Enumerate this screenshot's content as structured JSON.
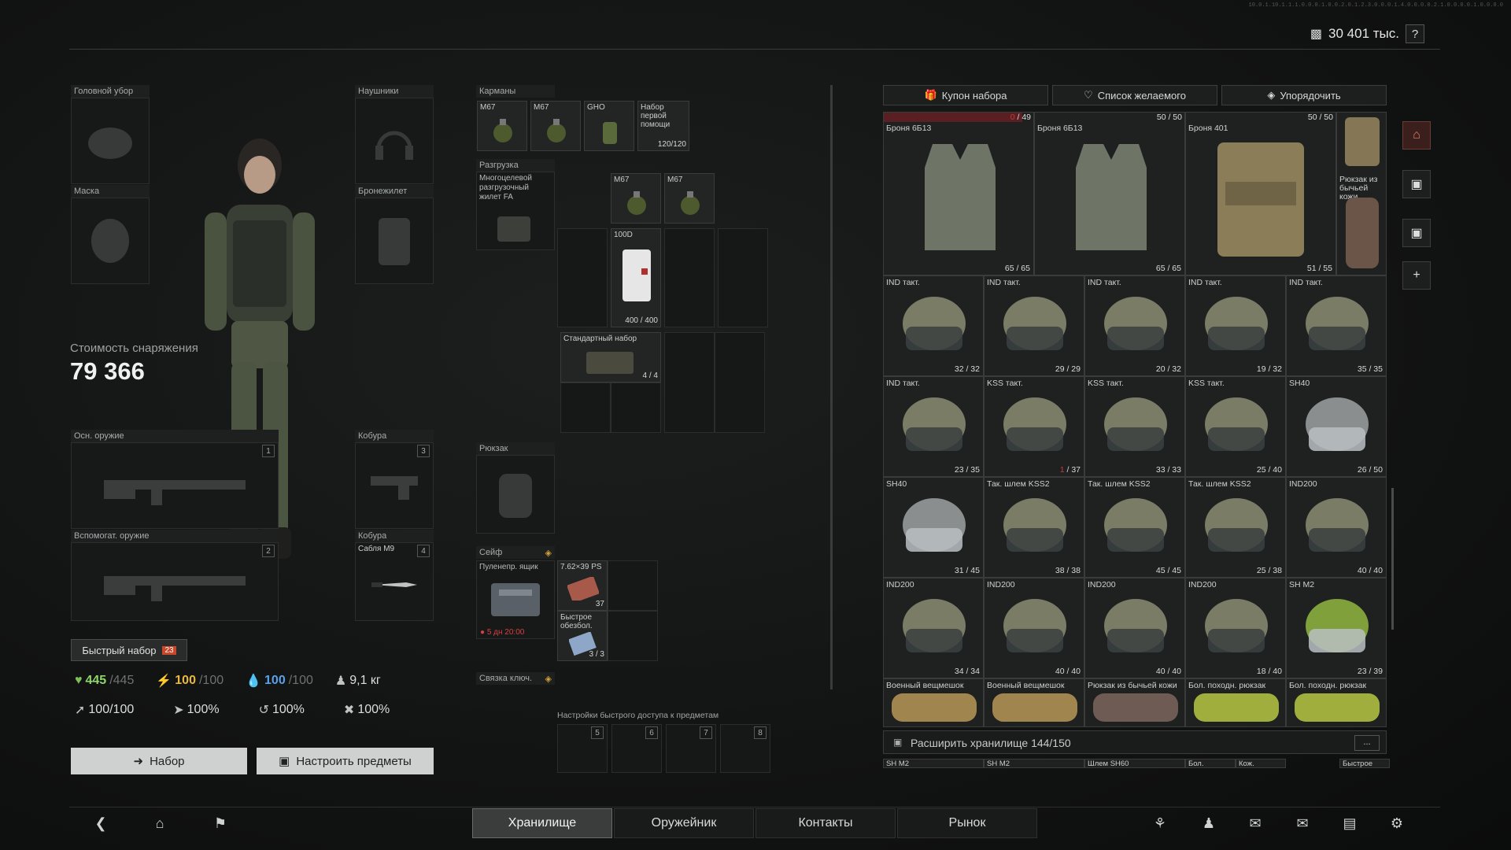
{
  "top": {
    "balance": "30 401 тыс.",
    "help": "?",
    "build": "10.0.1.10.1.1.1.0.0.0.1.0.0.2.0.1.2.3.0.0.0.1.4.0.0.0.0.2.1.0.0.0.0.1.0.0.0.0"
  },
  "equipment": {
    "headwear": "Головной убор",
    "earpiece": "Наушники",
    "facecover": "Маска",
    "armor": "Бронежилет",
    "primary": "Осн. оружие",
    "primary_num": "1",
    "holster1": "Кобура",
    "holster1_num": "3",
    "secondary": "Вспомогат. оружие",
    "secondary_num": "2",
    "holster2": "Кобура",
    "holster2_item": "Сабля М9",
    "holster2_num": "4"
  },
  "cost": {
    "label": "Стоимость снаряжения",
    "value": "79 366"
  },
  "quick_kit": {
    "label": "Быстрый набор",
    "badge": "23"
  },
  "stats": {
    "hp": "445",
    "hp_max": "/445",
    "energy": "100",
    "energy_max": "/100",
    "hydration": "100",
    "hydration_max": "/100",
    "weight": "9,1 кг",
    "aim": "100/100",
    "stat2": "100%",
    "stat3": "100%",
    "stat4": "100%"
  },
  "buttons": {
    "kit": "Набор",
    "configure": "Настроить предметы"
  },
  "pockets": {
    "label": "Карманы",
    "items": [
      {
        "name": "M67",
        "count": ""
      },
      {
        "name": "M67",
        "count": ""
      },
      {
        "name": "GHO",
        "count": ""
      },
      {
        "name": "Набор первой помощи",
        "count": "120/120"
      }
    ]
  },
  "rig": {
    "label": "Разгрузка",
    "item": "Многоцелевой разгрузочный жилет FA",
    "items": [
      {
        "name": "M67",
        "count": ""
      },
      {
        "name": "M67",
        "count": ""
      },
      {
        "name": "100D",
        "count": "400 / 400"
      },
      {
        "name": "Стандартный набор",
        "count": "4 / 4"
      }
    ]
  },
  "backpack": {
    "label": "Рюкзак"
  },
  "secure": {
    "label": "Сейф",
    "item": "Пуленепр. ящик",
    "timer": "5 дн 20:00",
    "ammo": {
      "name": "7.62×39 PS",
      "count": "37"
    },
    "aid": {
      "name": "Быстрое обезбол.",
      "count": "3 / 3"
    }
  },
  "keyring": {
    "label": "Связка ключ."
  },
  "quickbar": {
    "label": "Настройки быстрого доступа к предметам",
    "slots": [
      "5",
      "6",
      "7",
      "8"
    ]
  },
  "stash": {
    "buttons": {
      "coupon": "Купон набора",
      "wishlist": "Список желаемого",
      "sort": "Упорядочить"
    },
    "armor": [
      {
        "name": "Броня 6Б13",
        "top": "0 / 49",
        "bottom": "65 / 65"
      },
      {
        "name": "Броня 6Б13",
        "top": "50 / 50",
        "bottom": "65 / 65"
      },
      {
        "name": "Броня 401",
        "top": "50 / 50",
        "bottom": "51 / 55"
      },
      {
        "name": "Рюкзак из бычьей кожи",
        "top": "",
        "bottom": ""
      }
    ],
    "helmets": [
      {
        "name": "IND такт.",
        "count": "32 / 32"
      },
      {
        "name": "IND такт.",
        "count": "29 / 29"
      },
      {
        "name": "IND такт.",
        "count": "20 / 32"
      },
      {
        "name": "IND такт.",
        "count": "19 / 32"
      },
      {
        "name": "IND такт.",
        "count": "35 / 35"
      },
      {
        "name": "IND такт.",
        "count": "23 / 35"
      },
      {
        "name": "KSS такт.",
        "count": "1 / 37"
      },
      {
        "name": "KSS такт.",
        "count": "33 / 33"
      },
      {
        "name": "KSS такт.",
        "count": "25 / 40"
      },
      {
        "name": "SH40",
        "count": "26 / 50"
      },
      {
        "name": "SH40",
        "count": "31 / 45"
      },
      {
        "name": "Так. шлем KSS2",
        "count": "38 / 38"
      },
      {
        "name": "Так. шлем KSS2",
        "count": "45 / 45"
      },
      {
        "name": "Так. шлем KSS2",
        "count": "25 / 38"
      },
      {
        "name": "IND200",
        "count": "40 / 40"
      },
      {
        "name": "IND200",
        "count": "34 / 34"
      },
      {
        "name": "IND200",
        "count": "40 / 40"
      },
      {
        "name": "IND200",
        "count": "40 / 40"
      },
      {
        "name": "IND200",
        "count": "18 / 40"
      },
      {
        "name": "SH M2",
        "count": "23 / 39"
      }
    ],
    "bags": [
      {
        "name": "Военный вещмешок"
      },
      {
        "name": "Военный вещмешок"
      },
      {
        "name": "Рюкзак из бычьей кожи"
      },
      {
        "name": "Бол. походн. рюкзак"
      },
      {
        "name": "Бол. походн. рюкзак"
      }
    ],
    "expand": "Расширить хранилище 144/150",
    "expand_more": "...",
    "next_row": [
      "SH M2",
      "SH M2",
      "Шлем SH60",
      "Бол.",
      "Кож.",
      "Быстрое"
    ]
  },
  "tabs": [
    "Хранилище",
    "Оружейник",
    "Контакты",
    "Рынок"
  ]
}
